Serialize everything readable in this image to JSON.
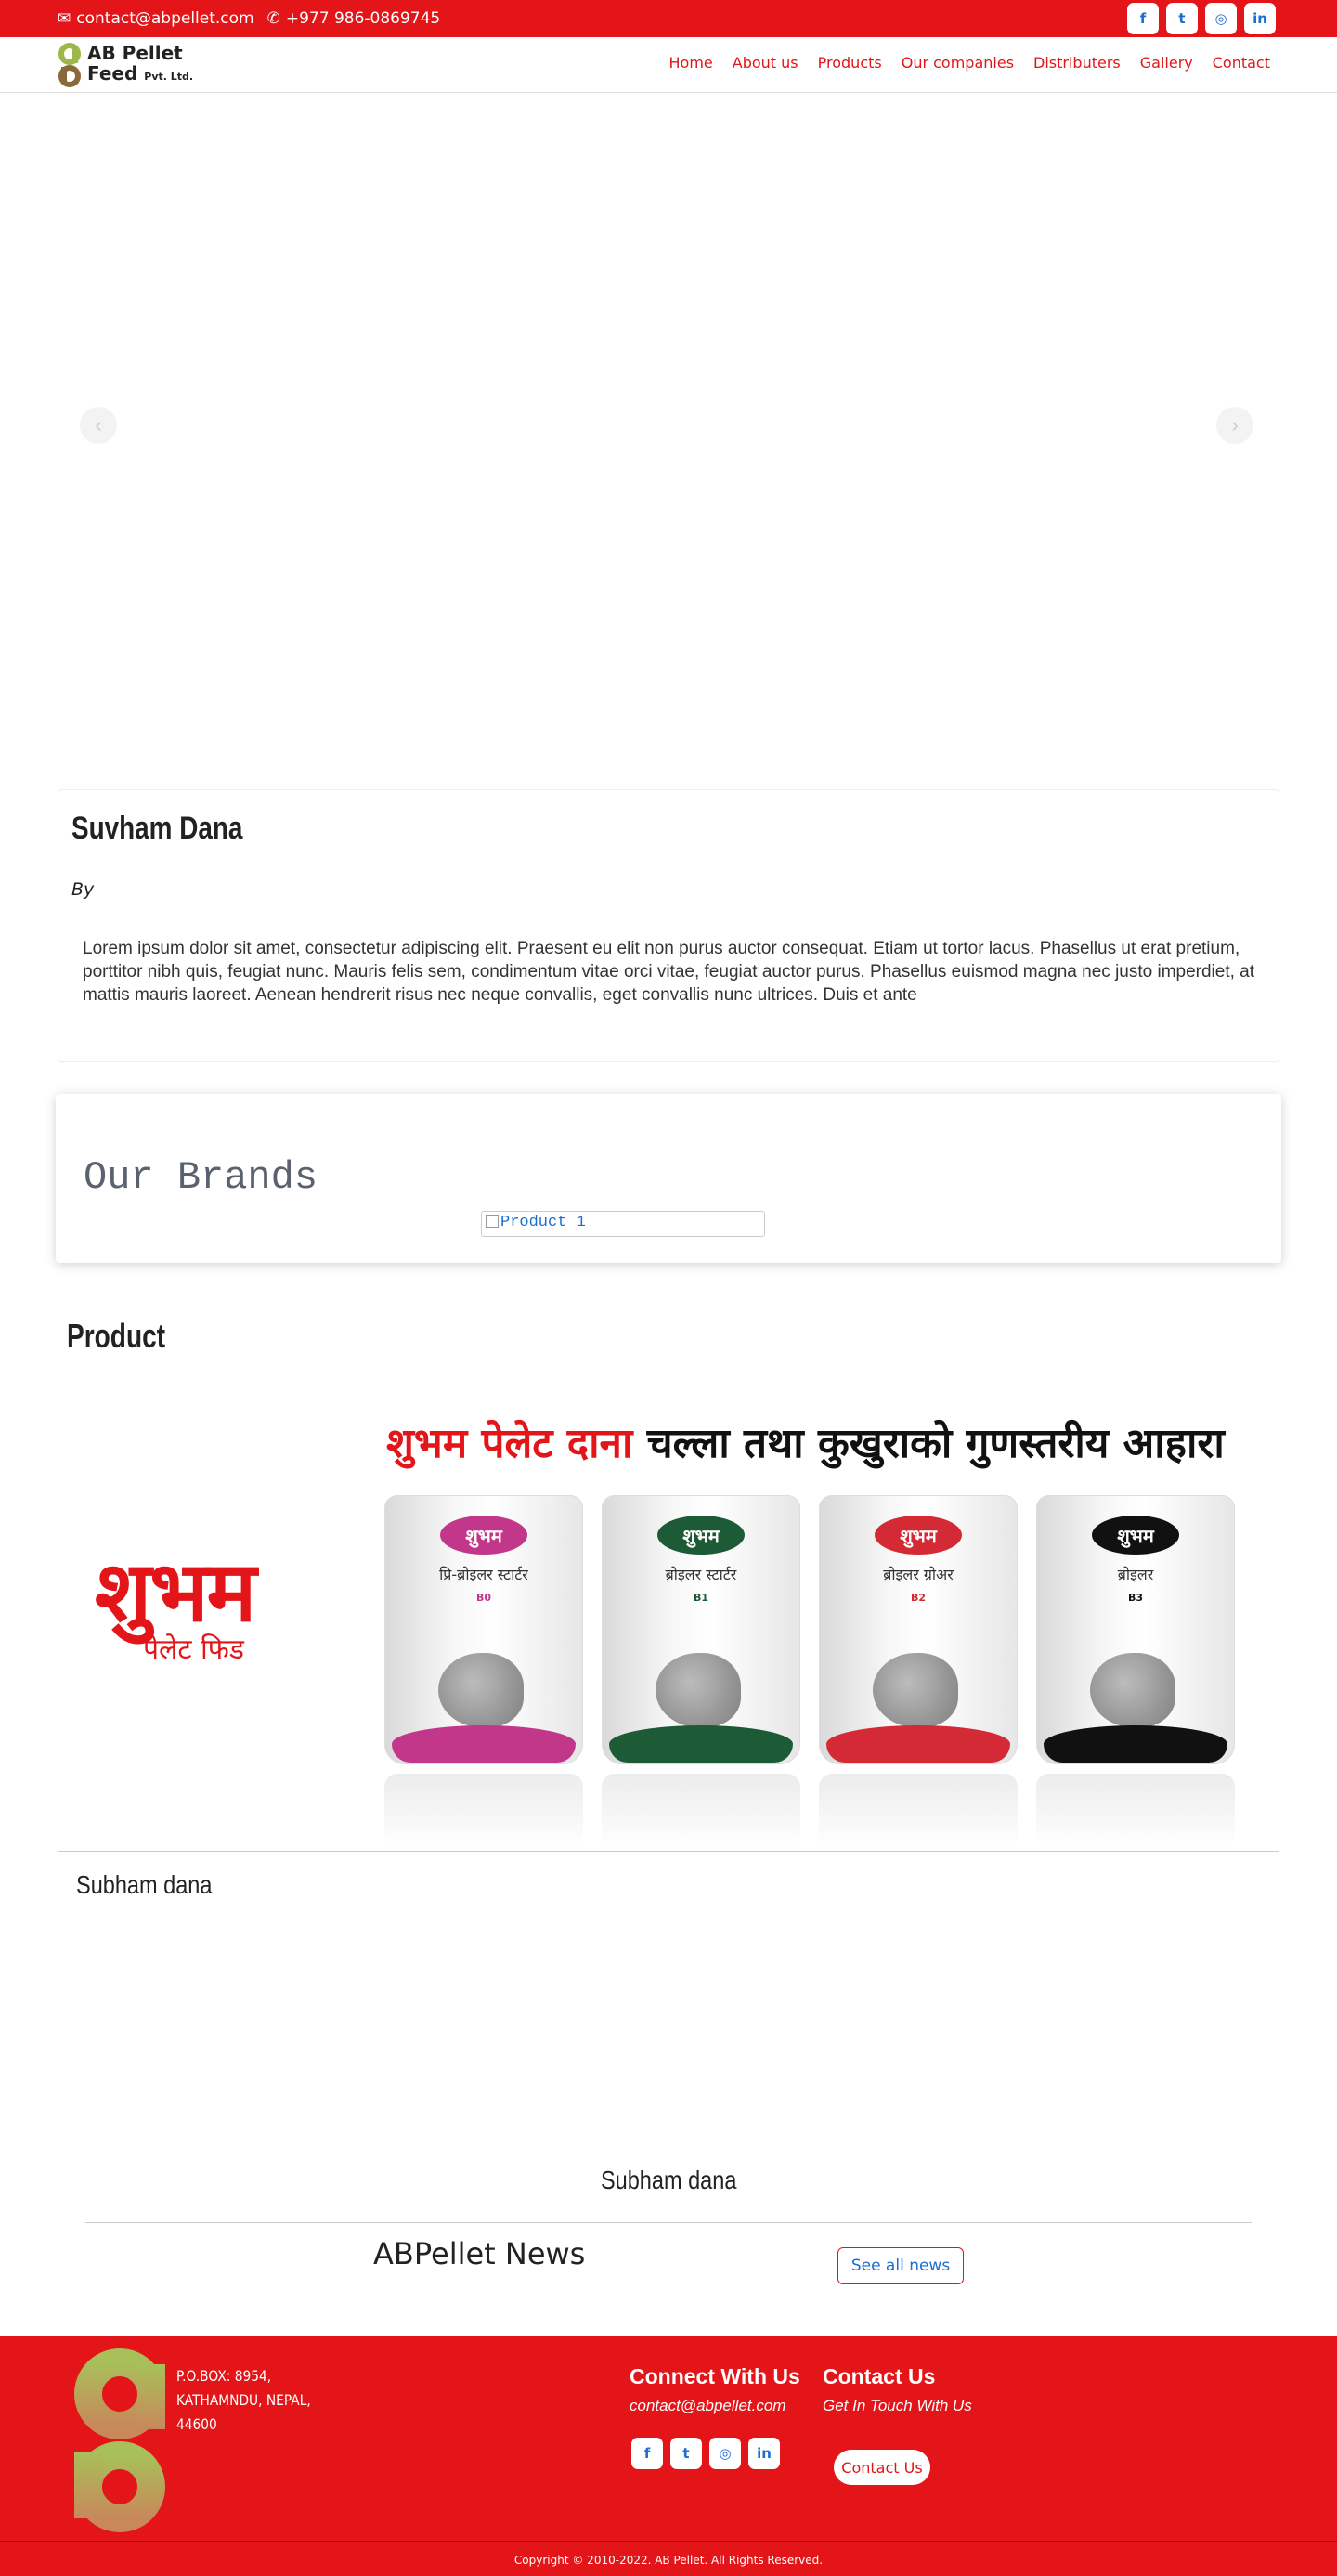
{
  "topbar": {
    "email": "contact@abpellet.com",
    "phone": "+977 986-0869745",
    "socials": [
      {
        "icon": "facebook-icon",
        "glyph": "f"
      },
      {
        "icon": "twitter-icon",
        "glyph": "t"
      },
      {
        "icon": "instagram-icon",
        "glyph": "◎"
      },
      {
        "icon": "linkedin-icon",
        "glyph": "in"
      }
    ]
  },
  "logo": {
    "line1": "AB Pellet",
    "line2": "Feed",
    "suffix": "Pvt. Ltd."
  },
  "nav": [
    "Home",
    "About us",
    "Products",
    "Our companies",
    "Distributers",
    "Gallery",
    "Contact"
  ],
  "carousel": {
    "prev": "‹",
    "next": "›"
  },
  "article": {
    "title": "Suvham Dana",
    "byline": "By",
    "body": "Lorem ipsum dolor sit amet, consectetur adipiscing elit. Praesent eu elit non purus auctor consequat. Etiam ut tortor lacus. Phasellus ut erat pretium, porttitor nibh quis, feugiat nunc. Mauris felis sem, condimentum vitae orci vitae, feugiat auctor purus. Phasellus euismod magna nec justo imperdiet, at mattis mauris laoreet. Aenean hendrerit risus nec neque convallis, eget convallis nunc ultrices. Duis et ante"
  },
  "brands": {
    "title": "Our Brands",
    "image_alt": "Product 1"
  },
  "product": {
    "section_title": "Product",
    "banner": {
      "tagline_red": "शुभम पेलेट दाना",
      "tagline_black": "चल्ला तथा कुखुराको गुणस्तरीय आहारा",
      "brand_big": "शुभम",
      "brand_sub": "पेलेट फिड",
      "bags": [
        {
          "badge": "शुभम",
          "name": "प्रि-ब्रोइलर स्टार्टर",
          "code": "B0",
          "color": "#c2378a"
        },
        {
          "badge": "शुभम",
          "name": "ब्रोइलर स्टार्टर",
          "code": "B1",
          "color": "#1d5a36"
        },
        {
          "badge": "शुभम",
          "name": "ब्रोइलर ग्रोअर",
          "code": "B2",
          "color": "#d42a35"
        },
        {
          "badge": "शुभम",
          "name": "ब्रोइलर",
          "code": "B3",
          "color": "#111111"
        }
      ]
    },
    "name": "Subham dana",
    "caption": "Subham dana"
  },
  "news": {
    "title": "ABPellet News",
    "button": "See all news"
  },
  "footer": {
    "address": [
      "P.O.BOX: 8954,",
      "KATHAMNDU, NEPAL,",
      "44600"
    ],
    "connect_title": "Connect With Us",
    "connect_email": "contact@abpellet.com",
    "contact_title": "Contact Us",
    "contact_sub": "Get In Touch With Us",
    "contact_button": "Contact Us",
    "copyright": "Copyright © 2010-2022. AB Pellet. All Rights Reserved."
  },
  "colors": {
    "brand_red": "#e31518",
    "link_blue": "#1c6ed1",
    "logo_green": "#9cb84a",
    "logo_brown": "#8a6a3a"
  }
}
